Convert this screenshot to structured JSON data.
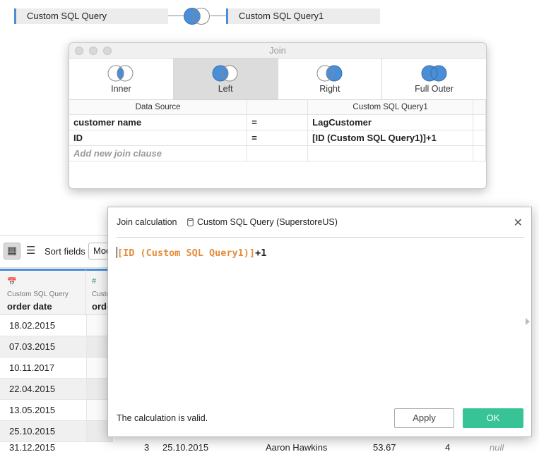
{
  "datasources": {
    "left": "Custom SQL Query",
    "right": "Custom SQL Query1"
  },
  "join_dialog": {
    "title": "Join",
    "types": [
      {
        "label": "Inner",
        "icon": "inner-join-icon"
      },
      {
        "label": "Left",
        "icon": "left-join-icon",
        "selected": true
      },
      {
        "label": "Right",
        "icon": "right-join-icon"
      },
      {
        "label": "Full Outer",
        "icon": "full-outer-join-icon"
      }
    ],
    "table_headers": {
      "left": "Data Source",
      "right": "Custom SQL Query1"
    },
    "clauses": [
      {
        "left": "customer name",
        "op": "=",
        "right": "LagCustomer"
      },
      {
        "left": "ID",
        "op": "=",
        "right": "[ID (Custom SQL Query1)]+1"
      }
    ],
    "add_clause": "Add new join clause"
  },
  "grid": {
    "sort_label": "Sort fields",
    "sort_value": "Mod",
    "columns": [
      {
        "icon": "calendar-icon",
        "source": "Custom SQL Query",
        "name": "order date"
      },
      {
        "icon": "hash-icon",
        "source": "Custo",
        "name": "orde"
      }
    ],
    "rows": [
      "18.02.2015",
      "07.03.2015",
      "10.11.2017",
      "22.04.2015",
      "13.05.2015",
      "25.10.2015"
    ],
    "bottom_row": [
      "31.12.2015",
      "3",
      "25.10.2015",
      "Aaron Hawkins",
      "53.67",
      "4",
      "null"
    ]
  },
  "calc_dialog": {
    "title": "Join calculation",
    "source": "Custom SQL Query (SuperstoreUS)",
    "formula_field": "[ID (Custom SQL Query1)]",
    "formula_op": "+1",
    "status": "The calculation is valid.",
    "apply_label": "Apply",
    "ok_label": "OK"
  },
  "colors": {
    "accent_blue": "#4a8ed8",
    "ok_green": "#38c397",
    "field_orange": "#e48c3a"
  }
}
